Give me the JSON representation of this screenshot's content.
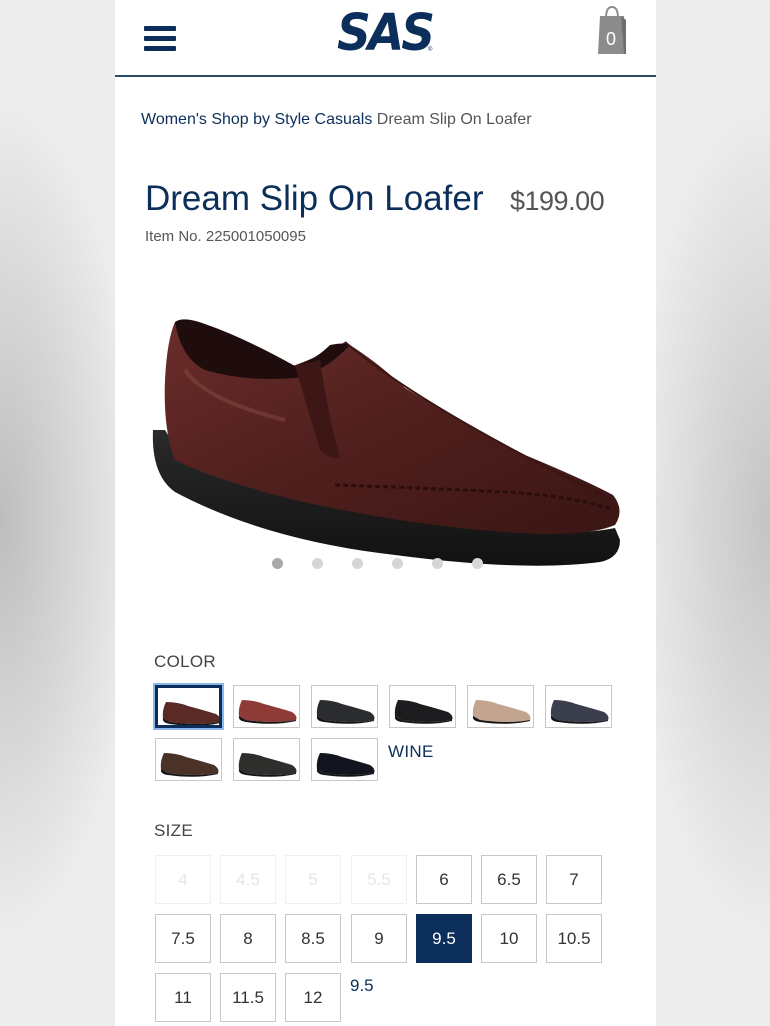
{
  "header": {
    "logo_text": "SAS",
    "logo_reg": "®",
    "cart_count": "0",
    "brand_color": "#0b2f5a"
  },
  "breadcrumb": {
    "items": [
      "Women's Shop by Style",
      "Casuals"
    ],
    "current": "Dream Slip On Loafer"
  },
  "product": {
    "title": "Dream Slip On Loafer",
    "price": "$199.00",
    "item_no": "Item No. 225001050095",
    "image_icon": "loafer-shoe-image",
    "image_count": 6,
    "active_image": 1
  },
  "color": {
    "label": "COLOR",
    "selected_name": "WINE",
    "swatches": [
      {
        "color": "#5a2a26",
        "selected": true
      },
      {
        "color": "#8e3a36",
        "selected": false
      },
      {
        "color": "#2a2c30",
        "selected": false
      },
      {
        "color": "#1d1d1f",
        "selected": false
      },
      {
        "color": "#c3a48f",
        "selected": false
      },
      {
        "color": "#3b3f4d",
        "selected": false
      },
      {
        "color": "#4b3226",
        "selected": false
      },
      {
        "color": "#2e2f2d",
        "selected": false
      },
      {
        "color": "#12151d",
        "selected": false
      }
    ]
  },
  "size": {
    "label": "SIZE",
    "selected_label": "9.5",
    "options": [
      {
        "label": "4",
        "available": false,
        "selected": false
      },
      {
        "label": "4.5",
        "available": false,
        "selected": false
      },
      {
        "label": "5",
        "available": false,
        "selected": false
      },
      {
        "label": "5.5",
        "available": false,
        "selected": false
      },
      {
        "label": "6",
        "available": true,
        "selected": false
      },
      {
        "label": "6.5",
        "available": true,
        "selected": false
      },
      {
        "label": "7",
        "available": true,
        "selected": false
      },
      {
        "label": "7.5",
        "available": true,
        "selected": false
      },
      {
        "label": "8",
        "available": true,
        "selected": false
      },
      {
        "label": "8.5",
        "available": true,
        "selected": false
      },
      {
        "label": "9",
        "available": true,
        "selected": false
      },
      {
        "label": "9.5",
        "available": true,
        "selected": true
      },
      {
        "label": "10",
        "available": true,
        "selected": false
      },
      {
        "label": "10.5",
        "available": true,
        "selected": false
      },
      {
        "label": "11",
        "available": true,
        "selected": false
      },
      {
        "label": "11.5",
        "available": true,
        "selected": false
      },
      {
        "label": "12",
        "available": true,
        "selected": false
      }
    ]
  }
}
